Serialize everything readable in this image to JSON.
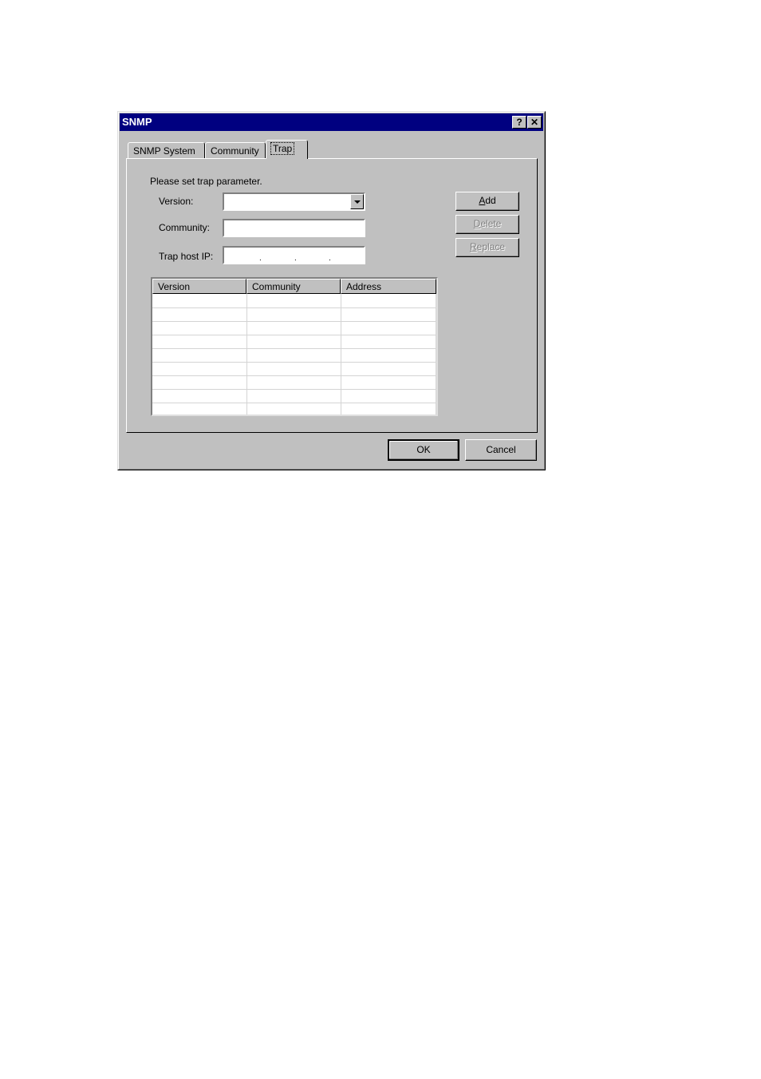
{
  "window": {
    "title": "SNMP",
    "help_label": "?",
    "close_label": "✕"
  },
  "tabs": [
    {
      "label": "SNMP System",
      "active": false
    },
    {
      "label": "Community",
      "active": false
    },
    {
      "label": "Trap",
      "active": true
    }
  ],
  "form": {
    "instruction": "Please set trap parameter.",
    "version_label": "Version:",
    "version_value": "",
    "community_label": "Community:",
    "community_value": "",
    "trap_host_ip_label": "Trap host IP:",
    "trap_host_ip_value": [
      "",
      "",
      "",
      ""
    ],
    "ip_separator": "."
  },
  "side_buttons": {
    "add": {
      "label": "Add",
      "mnemonic": "A",
      "rest": "dd",
      "enabled": true
    },
    "delete": {
      "label": "Delete",
      "mnemonic": "D",
      "rest": "elete",
      "enabled": false
    },
    "replace": {
      "label": "Replace",
      "mnemonic": "R",
      "rest": "eplace",
      "enabled": false
    }
  },
  "table": {
    "columns": [
      "Version",
      "Community",
      "Address"
    ],
    "rows": []
  },
  "footer": {
    "ok_label": "OK",
    "cancel_label": "Cancel"
  }
}
